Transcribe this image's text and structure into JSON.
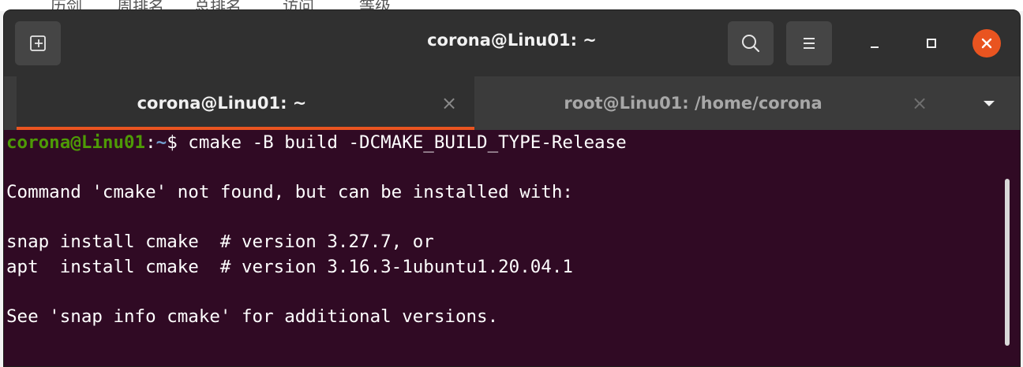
{
  "background_app": {
    "labels": [
      "历剑",
      "周排名",
      "总排名",
      "访问",
      "等级"
    ]
  },
  "window": {
    "title": "corona@Linu01: ~"
  },
  "header_buttons": {
    "new_tab_icon": "new-tab-icon",
    "search_icon": "search-icon",
    "menu_icon": "hamburger-menu-icon",
    "minimize_icon": "minimize-icon",
    "maximize_icon": "maximize-icon",
    "close_icon": "close-icon"
  },
  "tabs": [
    {
      "label": "corona@Linu01: ~",
      "close": "×",
      "active": true
    },
    {
      "label": "root@Linu01: /home/corona",
      "close": "×",
      "active": false
    }
  ],
  "terminal": {
    "prompt_user": "corona@Linu01",
    "prompt_sep": ":",
    "prompt_path": "~",
    "prompt_symbol": "$ ",
    "command": "cmake -B build -DCMAKE_BUILD_TYPE-Release",
    "output": [
      "",
      "Command 'cmake' not found, but can be installed with:",
      "",
      "snap install cmake  # version 3.27.7, or",
      "apt  install cmake  # version 3.16.3-1ubuntu1.20.04.1",
      "",
      "See 'snap info cmake' for additional versions."
    ]
  },
  "colors": {
    "accent": "#e95420",
    "terminal_bg": "#300a24",
    "prompt_user": "#4e9a06",
    "prompt_path": "#729fcf"
  }
}
